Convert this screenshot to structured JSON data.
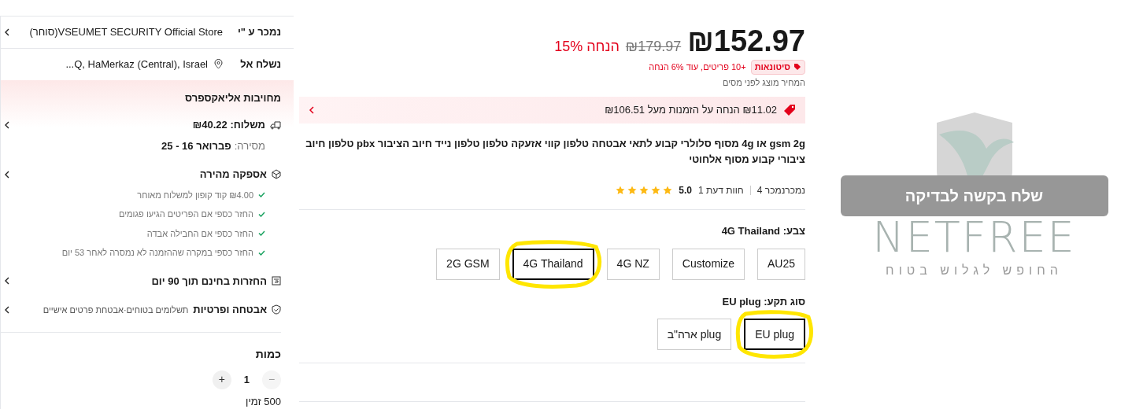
{
  "sidebar": {
    "seller": {
      "label": "נמכר ע \"י",
      "value": "VSEUMET SECURITY Official Store(סוחר)"
    },
    "ship_to": {
      "label": "נשלח אל",
      "value": "Q, HaMerkaz (Central), Israel..."
    },
    "commitment": {
      "title": "מחויבות אליאקספרס",
      "shipping": {
        "label": "משלוח: ₪40.22",
        "delivery_label": "מסירה:",
        "delivery_value": "פברואר 16 - 25"
      },
      "fast": {
        "title": "אספקה מהירה",
        "items": [
          "₪4.00 קוד קופון למשלוח מאוחר",
          "החזר כספי אם הפריטים הגיעו פגומים",
          "החזר כספי אם החבילה אבדה",
          "החזר כספי במקרה שההזמנה לא נמסרה לאחר 53 יום"
        ]
      },
      "returns": {
        "title": "החזרות בחינם תוך 90 יום"
      },
      "security": {
        "title": "אבטחה ופרטיות",
        "subtitle": "תשלומים בטוחים·אבטחת פרטים אישיים"
      }
    },
    "quantity": {
      "label": "כמות",
      "value": "1",
      "minus_symbol": "−",
      "plus_symbol": "+",
      "minus_disabled": true,
      "plus_disabled": false,
      "available": "500 זמין"
    }
  },
  "product": {
    "price": "₪152.97",
    "old_price": "₪179.97",
    "discount": "הנחה 15%",
    "wholesale_badge": "סיטונאות",
    "wholesale_text": "+10 פריטים, עוד 6% הנחה",
    "tax_note": "המחיר מוצג לפני מסים",
    "coupon": "₪11.02 הנחה על הזמנות מעל ₪106.51",
    "title": "gsm 2g או 4g מסוף סלולרי קבוע לתאי אבטחה טלפון קווי אזעקה טלפון טלפון נייד חיוב הציבור pbx טלפון חיוב ציבורי קבוע מסוף אלחוטי",
    "stars": 5,
    "rating": "5.0",
    "reviews": "חוות דעת 1",
    "sold": "נמכרנמכר 4",
    "option_groups": [
      {
        "label": "צבע: 4G Thailand",
        "options": [
          {
            "label": "AU25",
            "selected": false,
            "circled": false
          },
          {
            "label": "Customize",
            "selected": false,
            "circled": false
          },
          {
            "label": "4G NZ",
            "selected": false,
            "circled": false
          },
          {
            "label": "4G Thailand",
            "selected": true,
            "circled": true
          },
          {
            "label": "2G GSM",
            "selected": false,
            "circled": false
          }
        ]
      },
      {
        "label": "סוג תקע: EU plug",
        "options": [
          {
            "label": "EU plug",
            "selected": true,
            "circled": true
          },
          {
            "label": "plug ארה\"ב",
            "selected": false,
            "circled": false
          }
        ]
      }
    ]
  },
  "blocked_image": {
    "button": "שלח בקשה לבדיקה",
    "wordmark": "NETFREE",
    "tagline": "החופש לגלוש בטוח"
  }
}
